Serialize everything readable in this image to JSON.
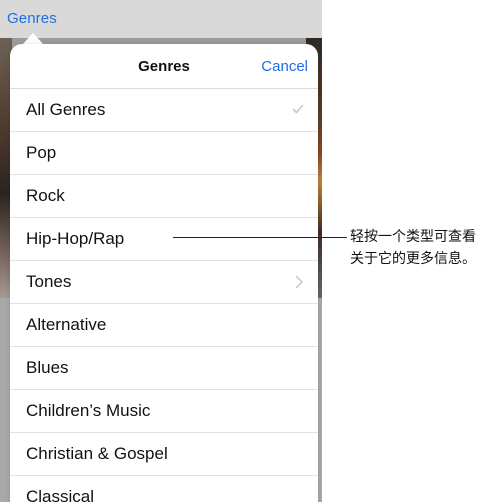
{
  "nav": {
    "back_label": "Genres"
  },
  "popover": {
    "title": "Genres",
    "cancel_label": "Cancel",
    "items": [
      {
        "label": "All Genres",
        "accessory": "checkmark-icon"
      },
      {
        "label": "Pop"
      },
      {
        "label": "Rock"
      },
      {
        "label": "Hip-Hop/Rap"
      },
      {
        "label": "Tones",
        "accessory": "chevron-right-icon"
      },
      {
        "label": "Alternative"
      },
      {
        "label": "Blues"
      },
      {
        "label": "Children’s Music"
      },
      {
        "label": "Christian & Gospel"
      },
      {
        "label": "Classical"
      }
    ]
  },
  "annotation": {
    "line1": "轻按一个类型可查看",
    "line2": "关于它的更多信息。"
  },
  "colors": {
    "accent": "#1f6ee6",
    "text": "#111111",
    "separator": "#e1e1e1",
    "accessory": "#c7c7cc"
  }
}
